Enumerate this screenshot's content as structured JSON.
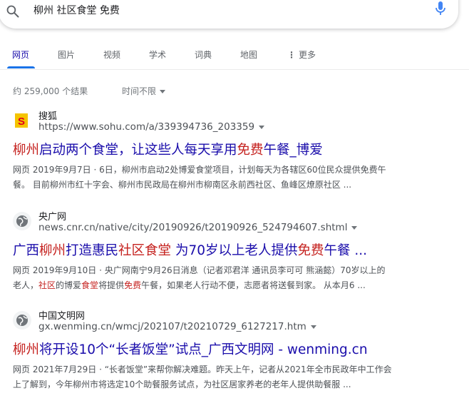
{
  "search": {
    "query": "柳州 社区食堂 免费"
  },
  "tabs": [
    {
      "label": "网页",
      "active": true
    },
    {
      "label": "图片"
    },
    {
      "label": "视频"
    },
    {
      "label": "学术"
    },
    {
      "label": "词典"
    },
    {
      "label": "地图"
    },
    {
      "label": "更多"
    }
  ],
  "stats": {
    "result_count": "约 259,000 个结果",
    "time_filter": "时间不限"
  },
  "results": [
    {
      "site": "搜狐",
      "url": "https://www.sohu.com/a/339394736_203359",
      "title_parts": [
        {
          "text": "柳州",
          "hl": true
        },
        {
          "text": "启动两个食堂，让这些人每天享用",
          "hl": false
        },
        {
          "text": "免费",
          "hl": true
        },
        {
          "text": "午餐_博爱",
          "hl": false
        }
      ],
      "snippet_line1_parts": [
        {
          "text": "网页  2019年9月7日 · 6日，柳州市启动2处博爱食堂项目，计划每天为各辖区60位民众提供免费午",
          "hl": false
        }
      ],
      "snippet_line2_parts": [
        {
          "text": "餐。 目前柳州市红十字会、柳州市民政局在柳州市柳南区永前西社区、鱼峰区燎原社区 ...",
          "hl": false
        }
      ]
    },
    {
      "site": "央广网",
      "url": "news.cnr.cn/native/city/20190926/t20190926_524794607.shtml",
      "title_parts": [
        {
          "text": "广西",
          "hl": false
        },
        {
          "text": "柳州",
          "hl": true
        },
        {
          "text": "打造惠民",
          "hl": false
        },
        {
          "text": "社区食堂",
          "hl": true
        },
        {
          "text": " 为70岁以上老人提供",
          "hl": false
        },
        {
          "text": "免费",
          "hl": true
        },
        {
          "text": "午餐 ...",
          "hl": false
        }
      ],
      "snippet_line1_parts": [
        {
          "text": "网页  2019年9月10日 · 央广网南宁9月26日消息（记者邓君洋 通讯员李可可 熊涵懿）70岁以上的",
          "hl": false
        }
      ],
      "snippet_line2_parts": [
        {
          "text": "老人，",
          "hl": false
        },
        {
          "text": "社区",
          "hl": true
        },
        {
          "text": "的博爱",
          "hl": false
        },
        {
          "text": "食堂",
          "hl": true
        },
        {
          "text": "将提供",
          "hl": false
        },
        {
          "text": "免费",
          "hl": true
        },
        {
          "text": "午餐，如果老人行动不便，志愿者将送餐到家。 从本月6 ...",
          "hl": false
        }
      ]
    },
    {
      "site": "中国文明网",
      "url": "gx.wenming.cn/wmcj/202107/t20210729_6127217.htm",
      "title_parts": [
        {
          "text": "柳州",
          "hl": true
        },
        {
          "text": "将开设10个“长者饭堂”试点_广西文明网 - wenming.cn",
          "hl": false
        }
      ],
      "snippet_line1_parts": [
        {
          "text": "网页  2021年7月29日 · “长者饭堂”来帮你解决难题。昨天上午，记者从2021年全市民政年中工作会",
          "hl": false
        }
      ],
      "snippet_line2_parts": [
        {
          "text": "上了解到，今年柳州市将选定10个助餐服务试点，为社区居家养老的老年人提供助餐服 ...",
          "hl": false
        }
      ]
    }
  ],
  "colors": {
    "link": "#1a0dab",
    "highlight": "#c5221f",
    "accent": "#1a73e8",
    "mic": "#4285f4"
  }
}
